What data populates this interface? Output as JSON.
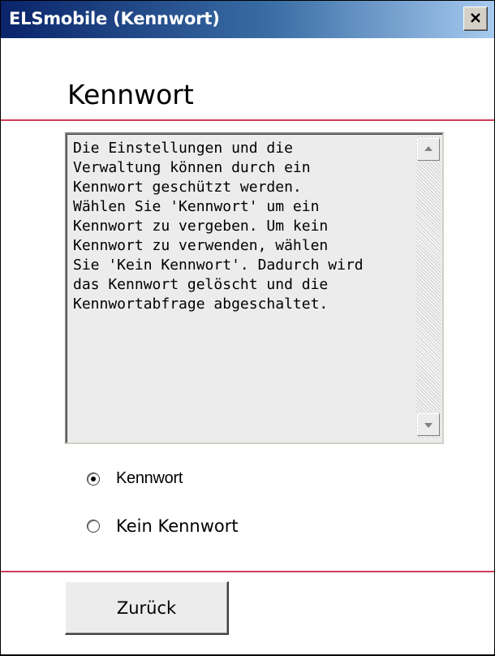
{
  "window": {
    "title": "ELSmobile (Kennwort)",
    "close_icon": "close-icon"
  },
  "page": {
    "heading": "Kennwort"
  },
  "info": {
    "text": "Die Einstellungen und die\nVerwaltung können durch ein\nKennwort geschützt werden.\nWählen Sie 'Kennwort' um ein\nKennwort zu vergeben. Um kein\nKennwort zu verwenden, wählen\nSie 'Kein Kennwort'. Dadurch wird\ndas Kennwort gelöscht und die\nKennwortabfrage abgeschaltet."
  },
  "options": [
    {
      "label": "Kennwort",
      "selected": true
    },
    {
      "label": "Kein Kennwort",
      "selected": false
    }
  ],
  "footer": {
    "back_label": "Zurück"
  },
  "colors": {
    "accent_rule": "#d23c5a",
    "title_bar": "#0a246a"
  }
}
